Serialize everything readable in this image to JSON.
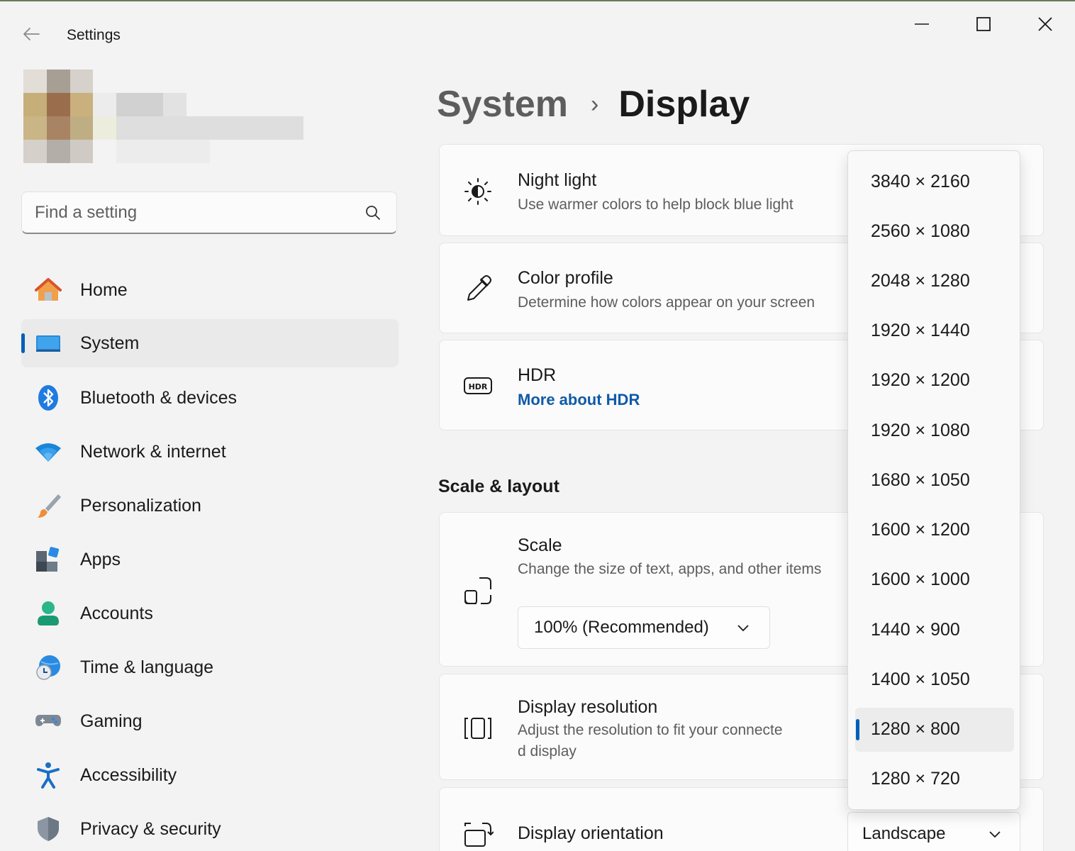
{
  "app": {
    "title": "Settings"
  },
  "search": {
    "placeholder": "Find a setting"
  },
  "sidebar": {
    "items": [
      {
        "label": "Home",
        "icon": "home-icon",
        "active": false
      },
      {
        "label": "System",
        "icon": "system-icon",
        "active": true
      },
      {
        "label": "Bluetooth & devices",
        "icon": "bluetooth-icon",
        "active": false
      },
      {
        "label": "Network & internet",
        "icon": "wifi-icon",
        "active": false
      },
      {
        "label": "Personalization",
        "icon": "brush-icon",
        "active": false
      },
      {
        "label": "Apps",
        "icon": "apps-icon",
        "active": false
      },
      {
        "label": "Accounts",
        "icon": "account-icon",
        "active": false
      },
      {
        "label": "Time & language",
        "icon": "globe-clock-icon",
        "active": false
      },
      {
        "label": "Gaming",
        "icon": "gamepad-icon",
        "active": false
      },
      {
        "label": "Accessibility",
        "icon": "accessibility-icon",
        "active": false
      },
      {
        "label": "Privacy & security",
        "icon": "shield-icon",
        "active": false
      }
    ]
  },
  "breadcrumb": {
    "parent": "System",
    "separator": "›",
    "current": "Display"
  },
  "cards": {
    "night_light": {
      "title": "Night light",
      "subtitle": "Use warmer colors to help block blue light"
    },
    "color_profile": {
      "title": "Color profile",
      "subtitle": "Determine how colors appear on your screen"
    },
    "hdr": {
      "title": "HDR",
      "link": "More about HDR"
    },
    "scale": {
      "title": "Scale",
      "subtitle": "Change the size of text, apps, and other items",
      "value": "100% (Recommended)"
    },
    "resolution": {
      "title": "Display resolution",
      "subtitle_line1": "Adjust the resolution to fit your connecte",
      "subtitle_line2": "d display"
    },
    "orientation": {
      "title": "Display orientation",
      "value": "Landscape"
    }
  },
  "sections": {
    "scale_layout": "Scale & layout"
  },
  "resolution_options": [
    "3840 × 2160",
    "2560 × 1080",
    "2048 × 1280",
    "1920 × 1440",
    "1920 × 1200",
    "1920 × 1080",
    "1680 × 1050",
    "1600 × 1200",
    "1600 × 1000",
    "1440 × 900",
    "1400 × 1050",
    "1280 × 800",
    "1280 × 720"
  ],
  "resolution_selected": "1280 × 800",
  "colors": {
    "accent": "#005fb8",
    "link": "#0f5aa8",
    "background": "#f3f3f3",
    "card": "#fbfbfb"
  }
}
